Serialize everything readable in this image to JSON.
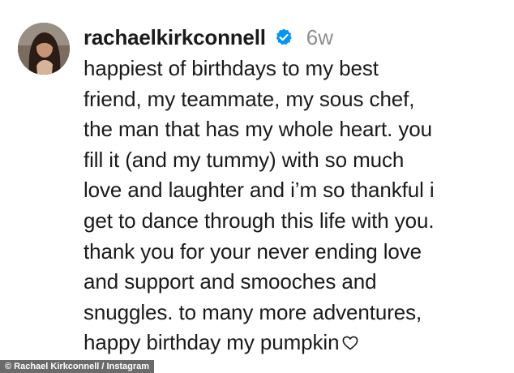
{
  "post": {
    "username": "rachaelkirkconnell",
    "time_ago": "6w",
    "verified": true,
    "caption_lines": [
      "happiest of birthdays to my best",
      "friend, my teammate, my sous chef,",
      "the man that has my whole heart. you",
      "fill it (and my tummy) with so much",
      "love and laughter and i’m so thankful i",
      "get to dance through this life with you.",
      "thank you for your never ending love",
      "and support and smooches and",
      "snuggles. to many more adventures,",
      "happy birthday my pumpkin"
    ],
    "trailing_icon": "heart-outline-icon"
  },
  "credit": {
    "text": "© Rachael Kirkconnell / Instagram"
  },
  "colors": {
    "background": "#ffffff",
    "text": "#1a1a1a",
    "muted": "#8e8e8e",
    "verified_badge": "#0095f6",
    "credit_background": "#6b6b6b"
  }
}
